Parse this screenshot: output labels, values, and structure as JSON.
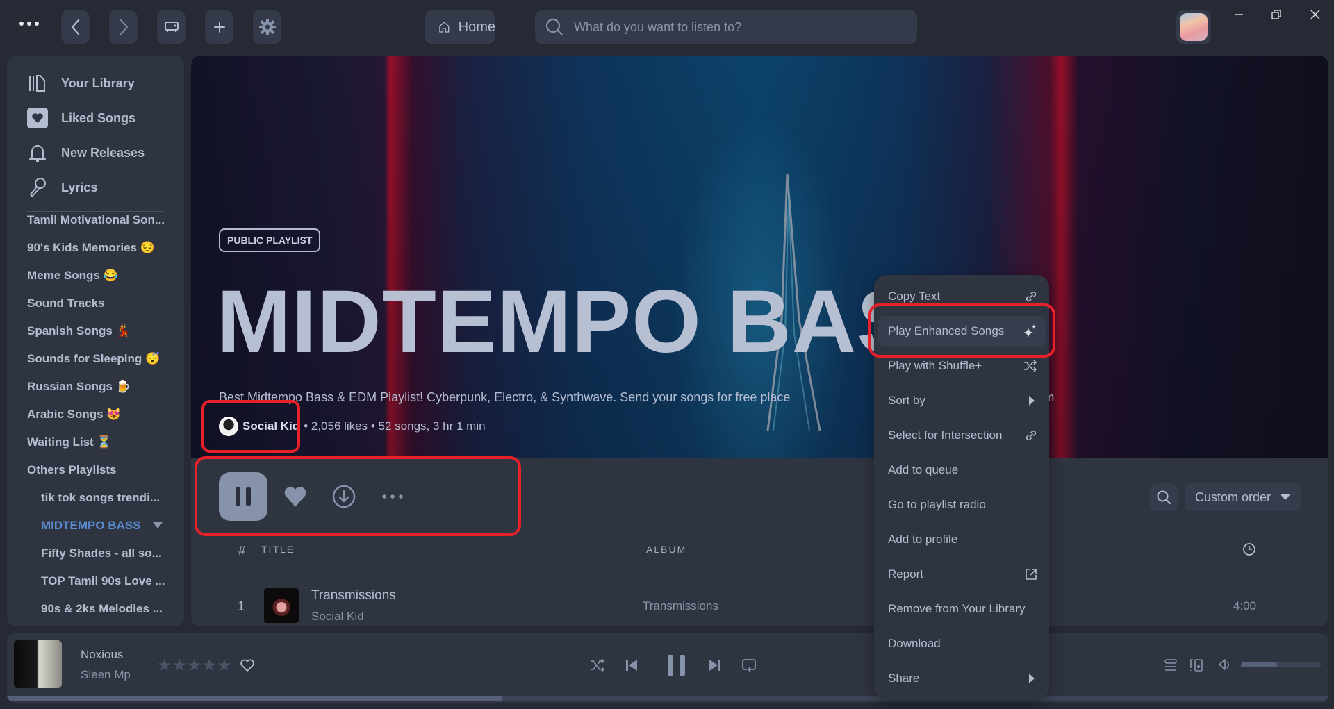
{
  "topbar": {
    "home_label": "Home",
    "search_placeholder": "What do you want to listen to?"
  },
  "sidebar": {
    "nav": [
      {
        "label": "Your Library",
        "icon": "library-icon"
      },
      {
        "label": "Liked Songs",
        "icon": "heart-icon"
      },
      {
        "label": "New Releases",
        "icon": "bell-icon"
      },
      {
        "label": "Lyrics",
        "icon": "microphone-icon"
      }
    ],
    "playlists": [
      "Tamil Motivational Son...",
      "90's Kids Memories 😔",
      "Meme Songs 😂",
      "Sound Tracks",
      "Spanish Songs 💃",
      "Sounds for Sleeping 😴",
      "Russian Songs 🍺",
      "Arabic Songs 😻",
      "Waiting List ⏳",
      "Others Playlists"
    ],
    "sub_playlists": [
      "tik tok songs trendi...",
      "MIDTEMPO BASS",
      "Fifty Shades - all so...",
      "TOP Tamil 90s Love ...",
      "90s & 2ks Melodies ..."
    ],
    "active_playlist": "MIDTEMPO BASS"
  },
  "playlist": {
    "badge": "PUBLIC PLAYLIST",
    "title": "MIDTEMPO BASS",
    "description": "Best Midtempo Bass & EDM Playlist! Cyberpunk, Electro, & Synthwave. Send your songs for free place",
    "description_tail": "ail.com",
    "owner": "Social Kid",
    "stats": "• 2,056 likes • 52 songs, 3 hr 1 min",
    "sort_label": "Custom order"
  },
  "table": {
    "headers": {
      "num": "#",
      "title": "TITLE",
      "album": "ALBUM"
    },
    "rows": [
      {
        "num": "1",
        "title": "Transmissions",
        "artist": "Social Kid",
        "album": "Transmissions",
        "duration": "4:00"
      }
    ]
  },
  "context_menu": {
    "items": [
      {
        "label": "Copy Text",
        "icon": "link-icon"
      },
      {
        "label": "Play Enhanced Songs",
        "icon": "sparkle-icon"
      },
      {
        "label": "Play with Shuffle+",
        "icon": "shuffle-icon"
      },
      {
        "label": "Sort by",
        "icon": "submenu-arrow-icon"
      },
      {
        "label": "Select for Intersection",
        "icon": "link-icon"
      },
      {
        "label": "Add to queue",
        "icon": ""
      },
      {
        "label": "Go to playlist radio",
        "icon": ""
      },
      {
        "label": "Add to profile",
        "icon": ""
      },
      {
        "label": "Report",
        "icon": "external-link-icon"
      },
      {
        "label": "Remove from Your Library",
        "icon": ""
      },
      {
        "label": "Download",
        "icon": ""
      },
      {
        "label": "Share",
        "icon": "submenu-arrow-icon"
      }
    ],
    "highlighted": "Play Enhanced Songs"
  },
  "player": {
    "track": "Noxious",
    "artist": "Sleen Mp",
    "rating": 0,
    "rating_max": 5,
    "progress_fraction": 0.375,
    "volume_fraction": 0.45
  },
  "colors": {
    "accent": "#5b8bd0",
    "highlight": "#e8202a",
    "surface": "#2f3441",
    "background": "#252a35"
  }
}
